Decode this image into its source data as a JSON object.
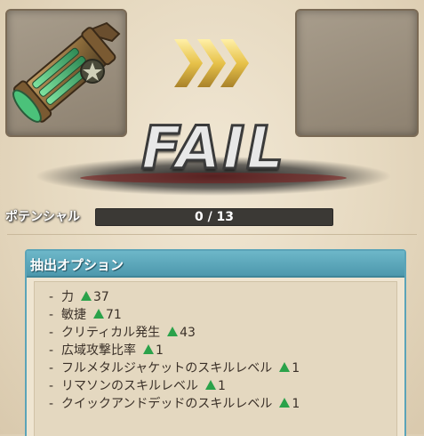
{
  "equipment": {
    "before_icon": "gatling-gun-weapon-icon",
    "after_icon": "empty-slot",
    "arrow_color": "#e7c24a"
  },
  "result": {
    "text": "FAIL"
  },
  "potential": {
    "label": "ポテンシャル",
    "value_text": "0 / 13",
    "current": 0,
    "max": 13
  },
  "options": {
    "title": "抽出オプション",
    "items": [
      {
        "prefix": "-",
        "name": "力",
        "value": "37"
      },
      {
        "prefix": "-",
        "name": "敏捷",
        "value": "71"
      },
      {
        "prefix": "-",
        "name": "クリティカル発生",
        "value": "43"
      },
      {
        "prefix": "-",
        "name": "広域攻撃比率",
        "value": "1"
      },
      {
        "prefix": "-",
        "name": "フルメタルジャケットのスキルレベル",
        "value": "1"
      },
      {
        "prefix": "-",
        "name": "リマソンのスキルレベル",
        "value": "1"
      },
      {
        "prefix": "-",
        "name": "クイックアンドデッドのスキルレベル",
        "value": "1"
      }
    ],
    "up_icon": "green-triangle-up-icon",
    "up_color": "#2aa24a"
  }
}
